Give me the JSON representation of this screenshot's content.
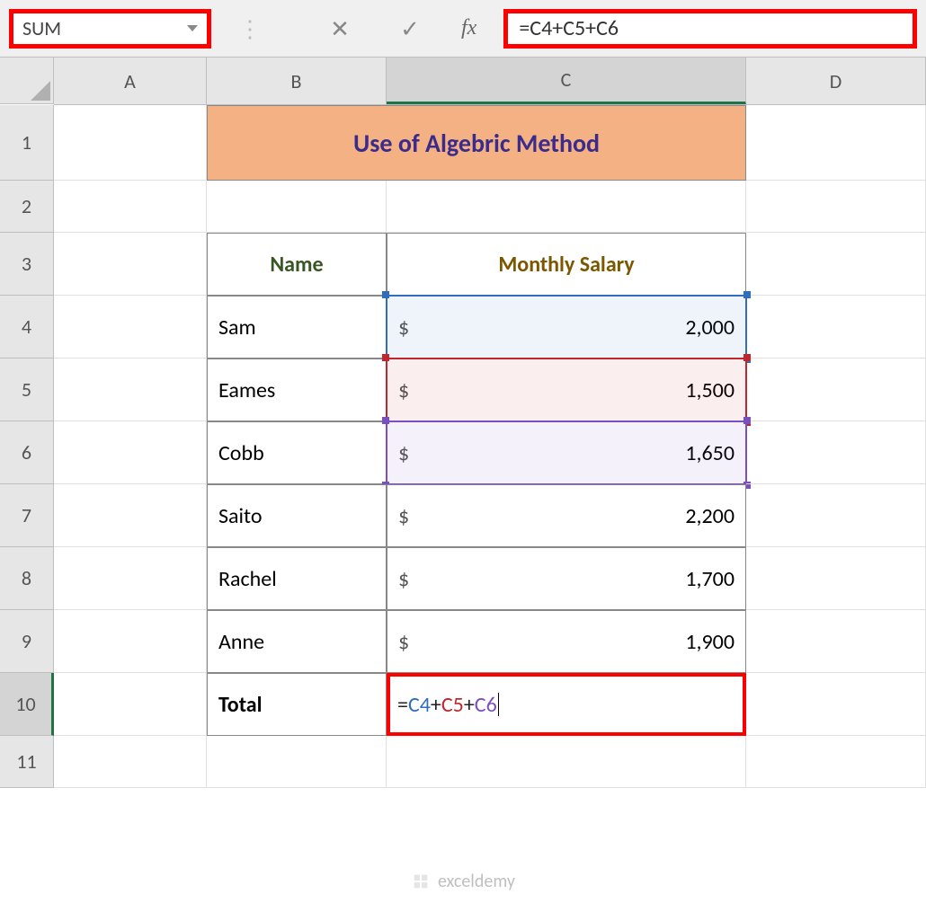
{
  "name_box": "SUM",
  "formula_input": "=C4+C5+C6",
  "columns": [
    "A",
    "B",
    "C",
    "D"
  ],
  "rows": [
    "1",
    "2",
    "3",
    "4",
    "5",
    "6",
    "7",
    "8",
    "9",
    "10",
    "11"
  ],
  "title": "Use of Algebric Method",
  "headers": {
    "name": "Name",
    "salary": "Monthly Salary"
  },
  "data_rows": [
    {
      "name": "Sam",
      "sign": "$",
      "value": "2,000"
    },
    {
      "name": "Eames",
      "sign": "$",
      "value": "1,500"
    },
    {
      "name": "Cobb",
      "sign": "$",
      "value": "1,650"
    },
    {
      "name": "Saito",
      "sign": "$",
      "value": "2,200"
    },
    {
      "name": "Rachel",
      "sign": "$",
      "value": "1,700"
    },
    {
      "name": "Anne",
      "sign": "$",
      "value": "1,900"
    }
  ],
  "total_label": "Total",
  "cell_formula": {
    "eq": "=",
    "r1": "C4",
    "plus1": "+",
    "r2": "C5",
    "plus2": "+",
    "r3": "C6"
  },
  "watermark": "exceldemy"
}
